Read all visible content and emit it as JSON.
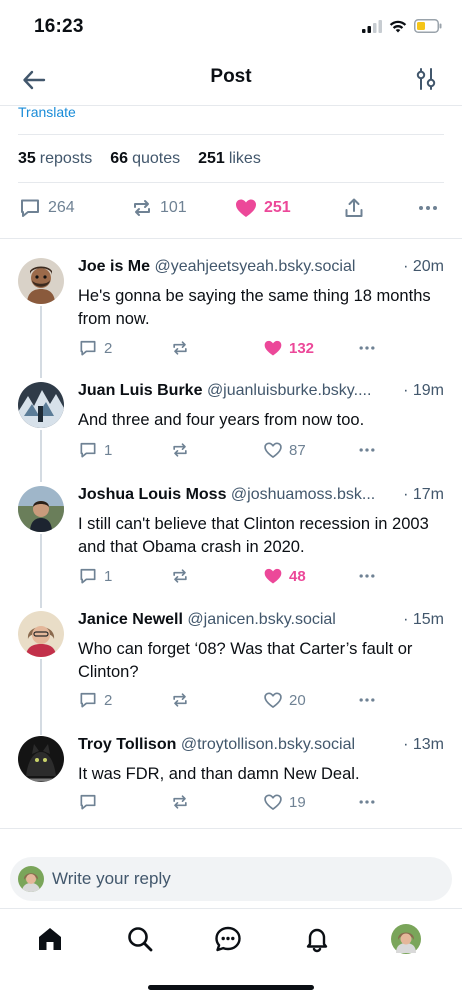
{
  "status": {
    "time": "16:23",
    "icons": [
      "signal-icon",
      "wifi-icon",
      "battery-icon"
    ]
  },
  "header": {
    "title": "Post",
    "back_icon": "back-arrow-icon",
    "filter_icon": "thread-settings-icon"
  },
  "post": {
    "translate_label": "Translate",
    "stats": {
      "reposts_count": "35",
      "reposts_label": "reposts",
      "quotes_count": "66",
      "quotes_label": "quotes",
      "likes_count": "251",
      "likes_label": "likes"
    },
    "actions": {
      "replies": "264",
      "reposts": "101",
      "likes": "251"
    }
  },
  "replies": [
    {
      "name": "Joe is Me",
      "handle": "@yeahjeetsyeah.bsky.social",
      "time": "· 20m",
      "text": "He's gonna be saying the same thing 18 months from now.",
      "replies": "2",
      "reposts": "",
      "likes": "132",
      "liked": true
    },
    {
      "name": "Juan Luis Burke",
      "handle": "@juanluisburke.bsky....",
      "time": "· 19m",
      "text": "And three and four years from now too.",
      "replies": "1",
      "reposts": "",
      "likes": "87",
      "liked": false
    },
    {
      "name": "Joshua Louis Moss",
      "handle": "@joshuamoss.bsk...",
      "time": "· 17m",
      "text": "I still can't believe that Clinton recession in 2003 and that Obama crash in 2020.",
      "replies": "1",
      "reposts": "",
      "likes": "48",
      "liked": true
    },
    {
      "name": "Janice Newell",
      "handle": "@janicen.bsky.social",
      "time": "· 15m",
      "text": "Who can forget ‘08? Was that Carter’s fault or Clinton?",
      "replies": "2",
      "reposts": "",
      "likes": "20",
      "liked": false
    },
    {
      "name": "Troy Tollison",
      "handle": "@troytollison.bsky.social",
      "time": "· 13m",
      "text": "It was FDR, and than damn New Deal.",
      "replies": "",
      "reposts": "",
      "likes": "19",
      "liked": false
    }
  ],
  "composer": {
    "placeholder": "Write your reply"
  },
  "tabbar": {
    "items": [
      "home-icon",
      "search-icon",
      "chat-icon",
      "notifications-icon",
      "profile-avatar"
    ]
  },
  "colors": {
    "like_pink": "#ec4899",
    "link_blue": "#1a8cd8",
    "muted": "#6f8294",
    "text": "#0b0f14"
  }
}
